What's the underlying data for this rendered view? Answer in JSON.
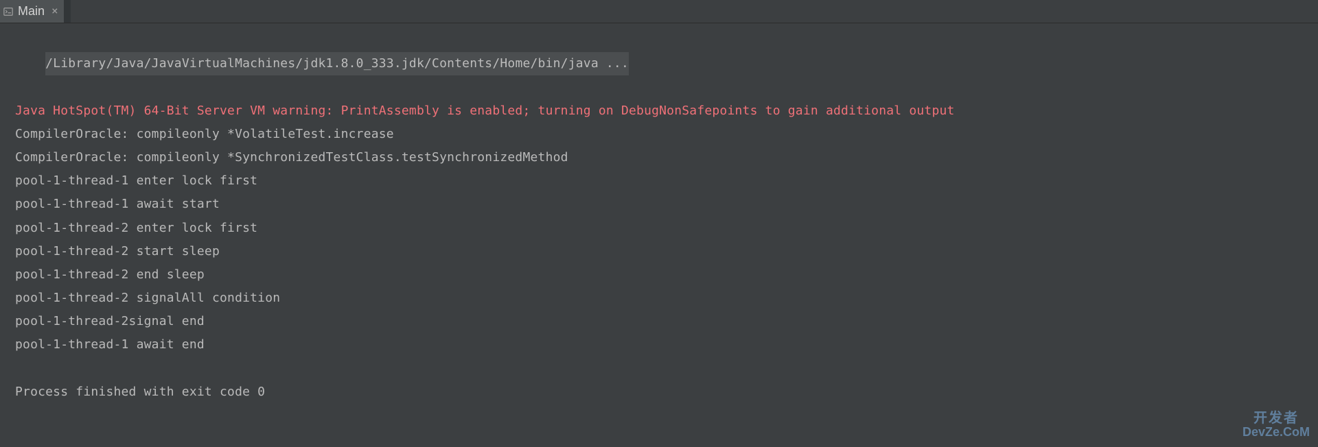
{
  "tab": {
    "label": "Main",
    "close_glyph": "×"
  },
  "console": {
    "command": "/Library/Java/JavaVirtualMachines/jdk1.8.0_333.jdk/Contents/Home/bin/java ...",
    "lines": [
      {
        "text": "Java HotSpot(TM) 64-Bit Server VM warning: PrintAssembly is enabled; turning on DebugNonSafepoints to gain additional output",
        "type": "warning"
      },
      {
        "text": "CompilerOracle: compileonly *VolatileTest.increase",
        "type": "normal"
      },
      {
        "text": "CompilerOracle: compileonly *SynchronizedTestClass.testSynchronizedMethod",
        "type": "normal"
      },
      {
        "text": "pool-1-thread-1 enter lock first",
        "type": "normal"
      },
      {
        "text": "pool-1-thread-1 await start",
        "type": "normal"
      },
      {
        "text": "pool-1-thread-2 enter lock first",
        "type": "normal"
      },
      {
        "text": "pool-1-thread-2 start sleep",
        "type": "normal"
      },
      {
        "text": "pool-1-thread-2 end sleep",
        "type": "normal"
      },
      {
        "text": "pool-1-thread-2 signalAll condition",
        "type": "normal"
      },
      {
        "text": "pool-1-thread-2signal end",
        "type": "normal"
      },
      {
        "text": "pool-1-thread-1 await end",
        "type": "normal"
      },
      {
        "text": "",
        "type": "empty"
      },
      {
        "text": "Process finished with exit code 0",
        "type": "normal"
      }
    ]
  },
  "watermark": {
    "zh": "开发者",
    "en": "DevZe.CoM"
  }
}
